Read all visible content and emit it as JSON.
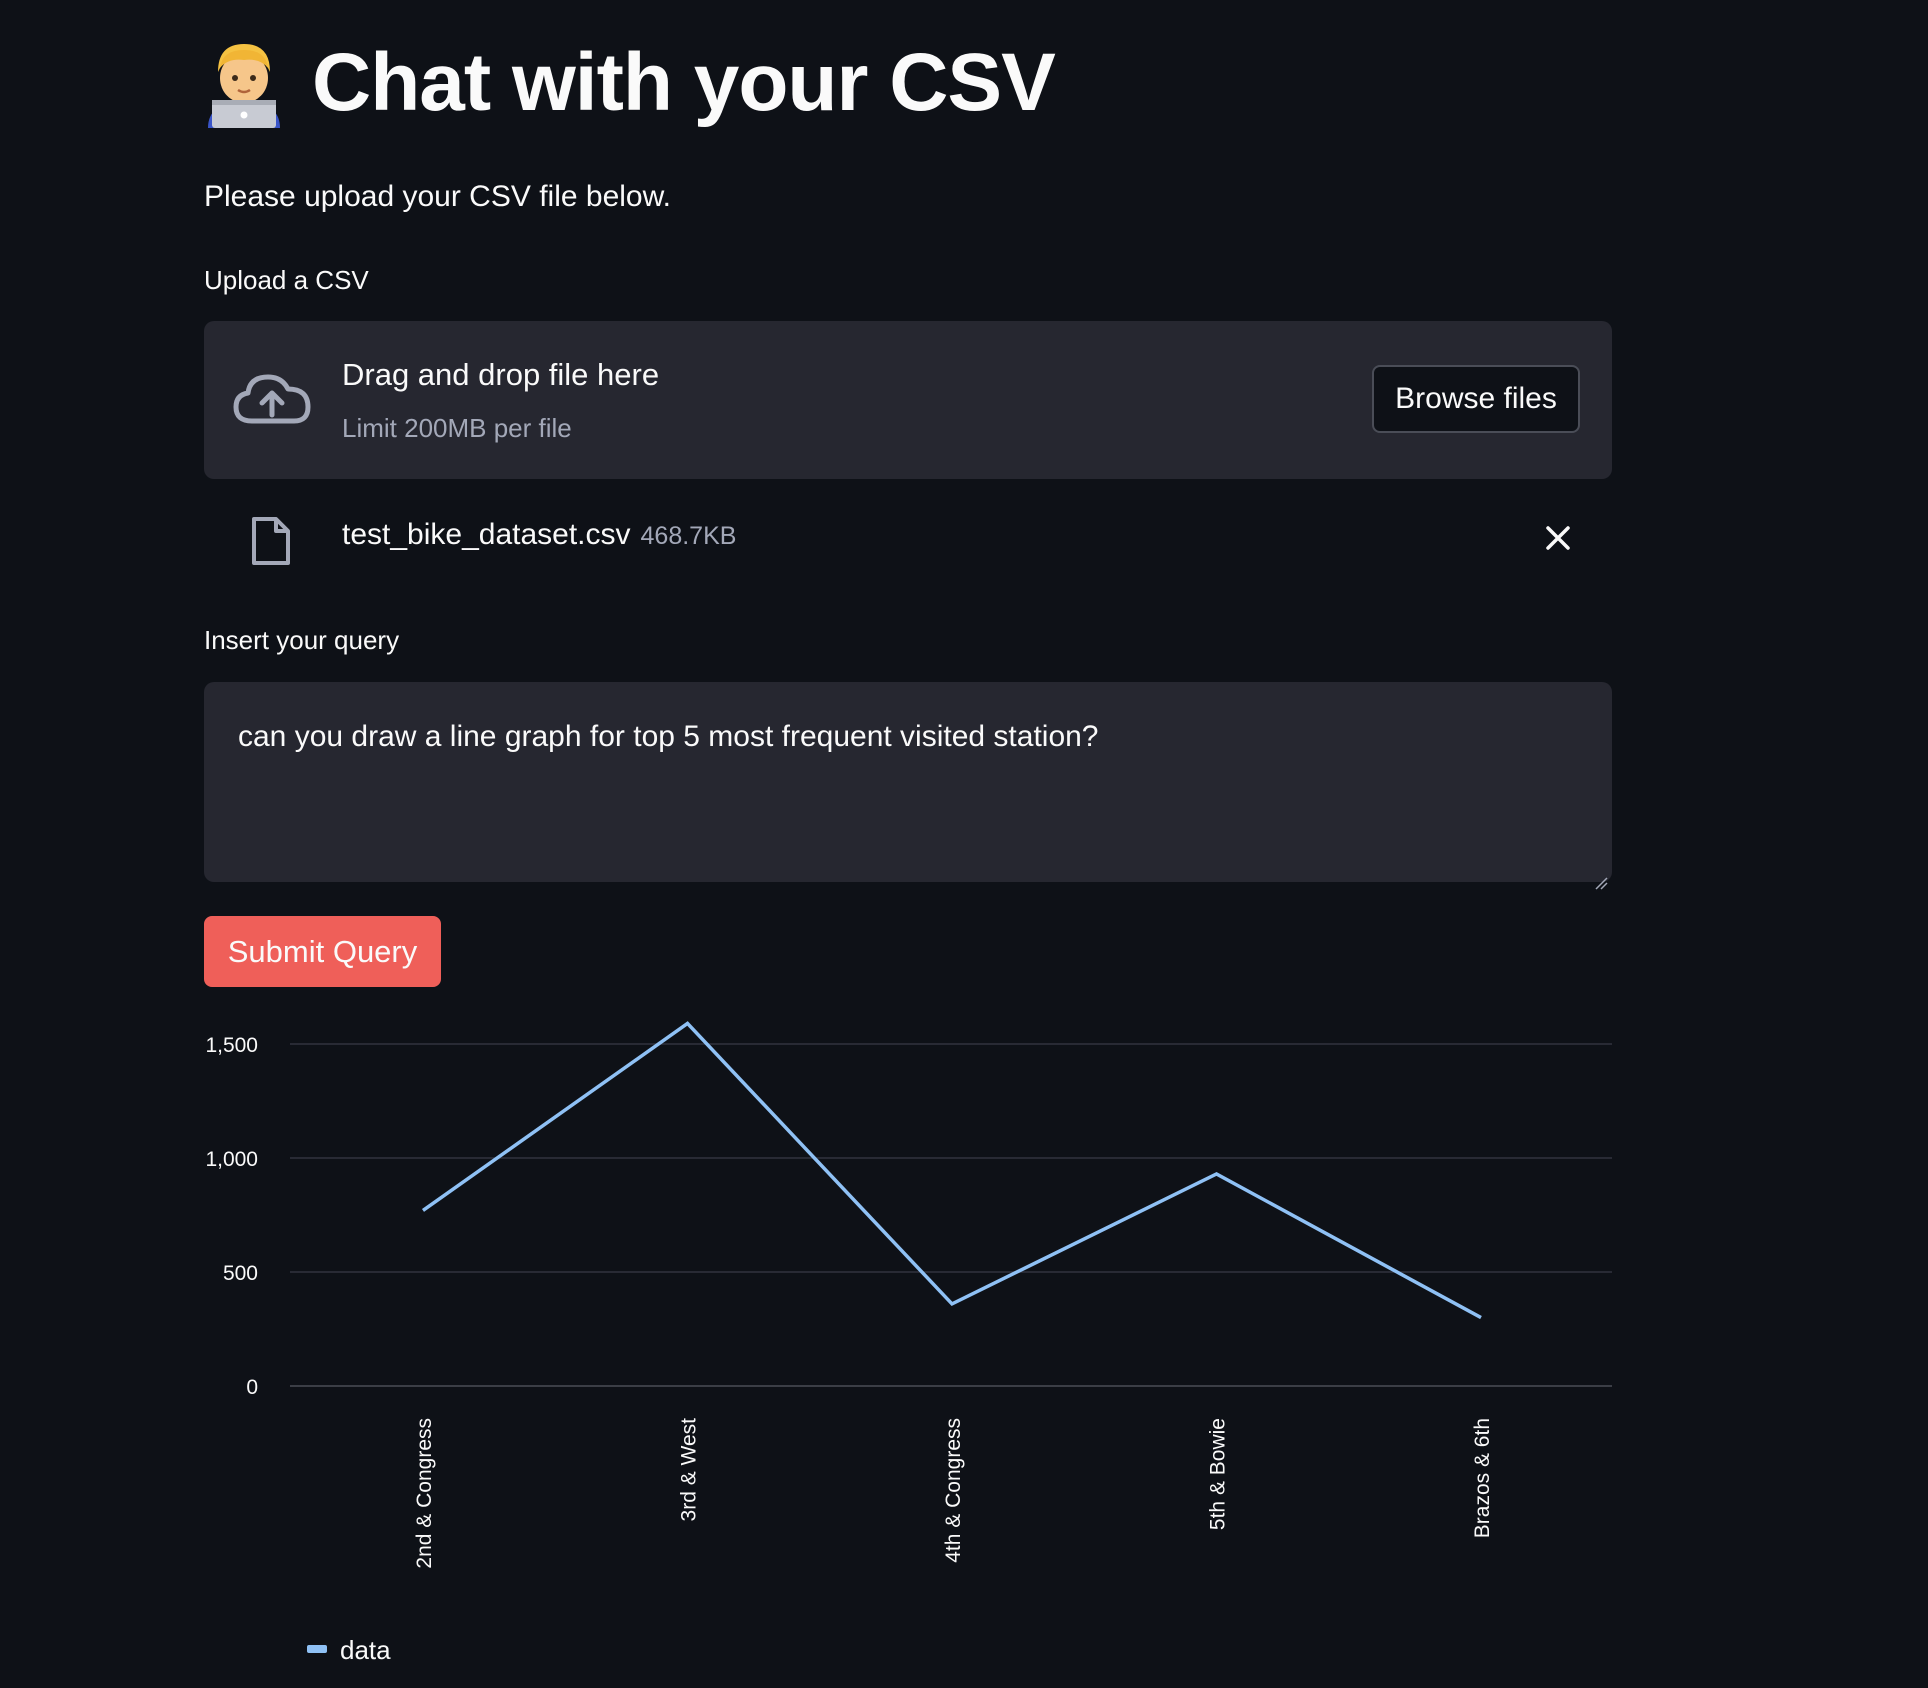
{
  "header": {
    "title": "Chat with your CSV",
    "subtitle": "Please upload your CSV file below."
  },
  "uploader": {
    "label": "Upload a CSV",
    "drag_text": "Drag and drop file here",
    "limit_text": "Limit 200MB per file",
    "browse_label": "Browse files",
    "icon": "cloud-upload-icon"
  },
  "file": {
    "name": "test_bike_dataset.csv",
    "size": "468.7KB",
    "icon": "file-icon"
  },
  "query": {
    "label": "Insert your query",
    "value": "can you draw a line graph for top 5 most frequent visited station?"
  },
  "submit": {
    "label": "Submit Query",
    "color": "#ef5f59"
  },
  "colors": {
    "background": "#0e1117",
    "panel": "#262730",
    "line": "#8fc1f5"
  },
  "chart_data": {
    "type": "line",
    "categories": [
      "2nd & Congress",
      "3rd & West",
      "4th & Congress",
      "5th & Bowie",
      "Brazos & 6th"
    ],
    "series": [
      {
        "name": "data",
        "values": [
          770,
          1590,
          360,
          930,
          300
        ]
      }
    ],
    "ylim": [
      0,
      1600
    ],
    "yticks": [
      0,
      500,
      1000,
      1500
    ],
    "ytick_labels": [
      "0",
      "500",
      "1,000",
      "1,500"
    ],
    "grid": true,
    "legend": "bottom-left"
  }
}
